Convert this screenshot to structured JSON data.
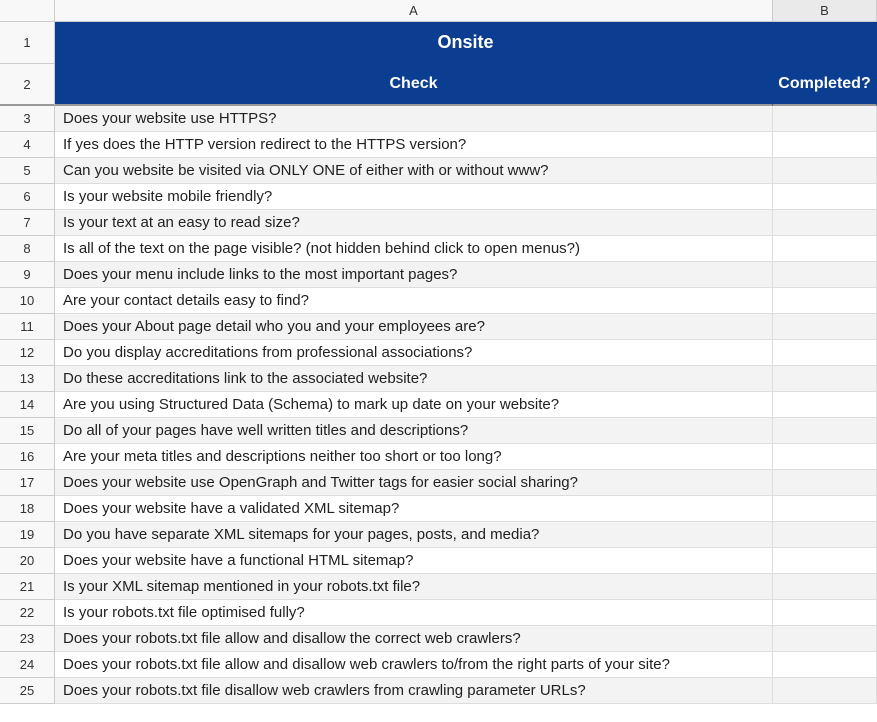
{
  "columns": {
    "A": "A",
    "B": "B"
  },
  "header": {
    "merged_title": "Onsite",
    "col_a": "Check",
    "col_b": "Completed?"
  },
  "rows": [
    {
      "num": "3",
      "check": "Does your website use HTTPS?",
      "completed": ""
    },
    {
      "num": "4",
      "check": "If yes does the HTTP version redirect to the HTTPS version?",
      "completed": ""
    },
    {
      "num": "5",
      "check": "Can you website be visited via ONLY ONE of either with or without www?",
      "completed": ""
    },
    {
      "num": "6",
      "check": "Is your website mobile friendly?",
      "completed": ""
    },
    {
      "num": "7",
      "check": "Is your text at an easy to read size?",
      "completed": ""
    },
    {
      "num": "8",
      "check": "Is all of the text on the page visible? (not hidden behind click to open menus?)",
      "completed": ""
    },
    {
      "num": "9",
      "check": "Does your menu include links to the most important pages?",
      "completed": ""
    },
    {
      "num": "10",
      "check": "Are your contact details easy to find?",
      "completed": ""
    },
    {
      "num": "11",
      "check": "Does your About page detail who you and your employees are?",
      "completed": ""
    },
    {
      "num": "12",
      "check": "Do you display accreditations from professional associations?",
      "completed": ""
    },
    {
      "num": "13",
      "check": "Do these accreditations link to the associated website?",
      "completed": ""
    },
    {
      "num": "14",
      "check": "Are you using Structured Data (Schema) to mark up date on your website?",
      "completed": ""
    },
    {
      "num": "15",
      "check": "Do all of your pages have well written titles and descriptions?",
      "completed": ""
    },
    {
      "num": "16",
      "check": "Are your meta titles and descriptions neither too short or too long?",
      "completed": ""
    },
    {
      "num": "17",
      "check": "Does your website use OpenGraph and Twitter tags for easier social sharing?",
      "completed": ""
    },
    {
      "num": "18",
      "check": "Does your website have a validated XML sitemap?",
      "completed": ""
    },
    {
      "num": "19",
      "check": "Do you have separate XML sitemaps for your pages, posts, and media?",
      "completed": ""
    },
    {
      "num": "20",
      "check": "Does your website have a functional HTML sitemap?",
      "completed": ""
    },
    {
      "num": "21",
      "check": "Is your XML sitemap mentioned in your robots.txt file?",
      "completed": ""
    },
    {
      "num": "22",
      "check": "Is your robots.txt file optimised fully?",
      "completed": ""
    },
    {
      "num": "23",
      "check": "Does your robots.txt file allow and disallow the correct web crawlers?",
      "completed": ""
    },
    {
      "num": "24",
      "check": "Does your robots.txt file allow and disallow web crawlers to/from the right parts of your site?",
      "completed": ""
    },
    {
      "num": "25",
      "check": "Does your robots.txt file disallow web crawlers from crawling parameter URLs?",
      "completed": ""
    }
  ],
  "row_numbers_header": {
    "r1": "1",
    "r2": "2"
  }
}
